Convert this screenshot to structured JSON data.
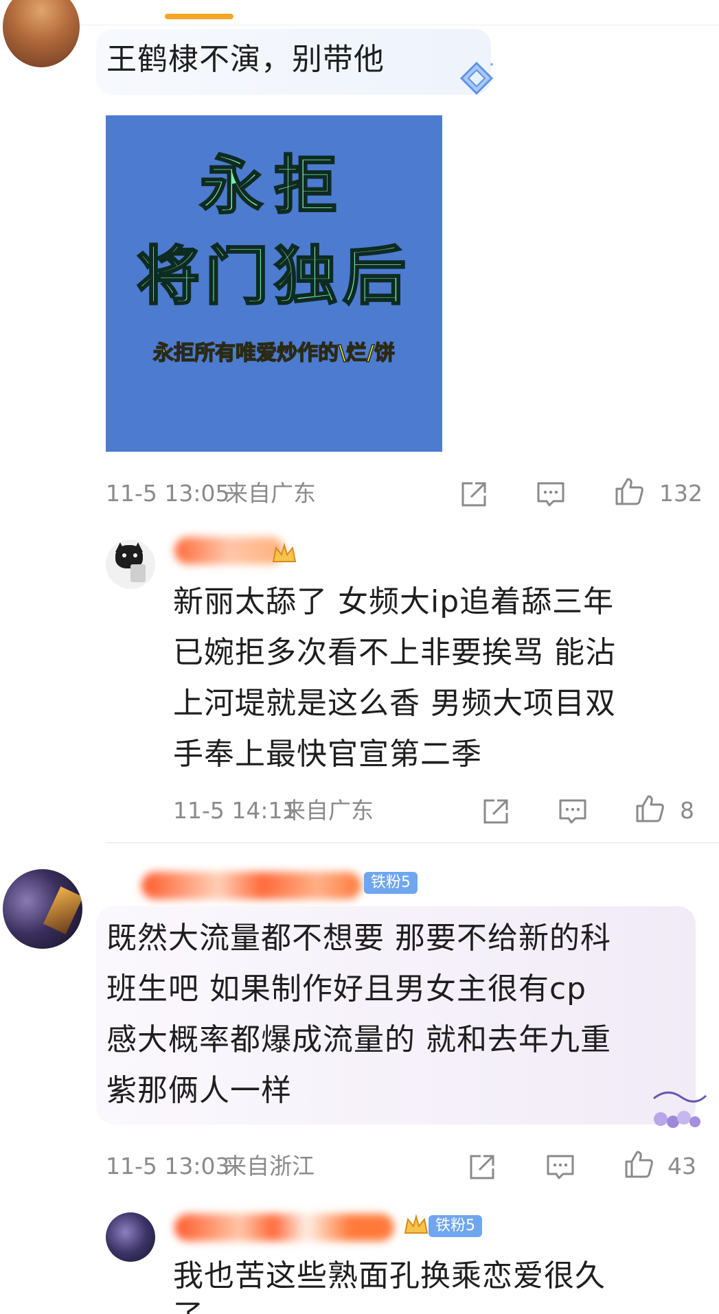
{
  "comments": [
    {
      "text": "王鹤棣不演，别带他",
      "poster": {
        "line1": "永拒",
        "line2": "将门独后",
        "line3": "永拒所有唯爱炒作的\\烂/饼"
      },
      "date": "11-5 13:05",
      "location": "来自广东",
      "likes": "132",
      "reply": {
        "text_lines": [
          "新丽太舔了 女频大ip追着舔三年",
          "已婉拒多次看不上非要挨骂 能沾",
          "上河堤就是这么香 男频大项目双",
          "手奉上最快官宣第二季"
        ],
        "date": "11-5 14:11",
        "location": "来自广东",
        "likes": "8"
      }
    },
    {
      "badge": "铁粉5",
      "text_lines": [
        "既然大流量都不想要 那要不给新的科",
        "班生吧 如果制作好且男女主很有cp",
        "感大概率都爆成流量的 就和去年九重",
        "紫那俩人一样"
      ],
      "date": "11-5 13:03",
      "location": "来自浙江",
      "likes": "43",
      "reply": {
        "badge": "铁粉5",
        "text_lines": [
          "我也苦这些熟面孔换乘恋爱很久",
          "了"
        ]
      }
    }
  ],
  "colors": {
    "accent": "#f5a623",
    "meta_gray": "#8a8a8a",
    "fan_badge": "#6fa6ef",
    "poster_bg": "#4d7bd0"
  },
  "icons": [
    "diamond-icon",
    "share-icon",
    "comment-icon",
    "like-icon",
    "crown-level-icon",
    "sticker-icon"
  ]
}
